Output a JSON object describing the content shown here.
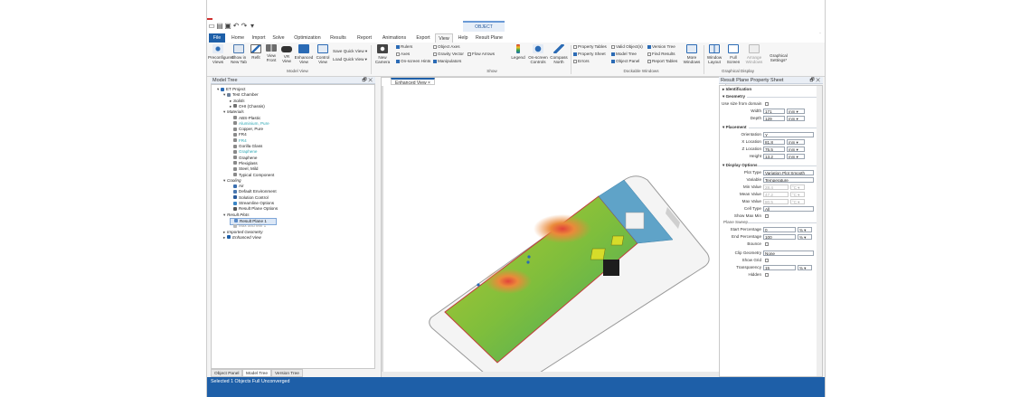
{
  "title_bar": {
    "context_tab_label": "OBJECT",
    "quick_access": [
      "new-icon",
      "open-icon",
      "save-icon",
      "undo-icon",
      "redo-icon",
      "dropdown-icon"
    ]
  },
  "tabs": [
    "File",
    "Home",
    "Import",
    "Solve",
    "Optimization",
    "Results",
    "Report",
    "Animations",
    "Export",
    "View",
    "Help",
    "Result Plane"
  ],
  "active_tab": "View",
  "ribbon": {
    "model_view": {
      "buttons": [
        "Preconfigured Views",
        "Show in New Tab",
        "Refit",
        "View Front",
        "VR View",
        "Enhanced View",
        "Control View"
      ],
      "quick_views": [
        "Save Quick View ▾",
        "Load Quick View ▾"
      ],
      "group_label": "Model View"
    },
    "new_camera": "New Camera",
    "show": {
      "checks": [
        {
          "label": "Rulers",
          "checked": true
        },
        {
          "label": "Axes",
          "checked": false
        },
        {
          "label": "On-screen Hints",
          "checked": true
        },
        {
          "label": "Object Axes",
          "checked": false
        },
        {
          "label": "Gravity Vector",
          "checked": false
        },
        {
          "label": "Flow Arrows",
          "checked": false
        },
        {
          "label": "Manipulators",
          "checked": true
        }
      ],
      "buttons": [
        "Legend",
        "On-screen Controls",
        "Compass North"
      ],
      "group_label": "Show"
    },
    "dockable": {
      "checks": [
        {
          "label": "Property Tables",
          "checked": false
        },
        {
          "label": "Property Sheet",
          "checked": true
        },
        {
          "label": "Errors",
          "checked": false
        },
        {
          "label": "Valid Object(s)",
          "checked": false
        },
        {
          "label": "Model Tree",
          "checked": true
        },
        {
          "label": "Object Panel",
          "checked": true
        },
        {
          "label": "Version Tree",
          "checked": true
        },
        {
          "label": "Find Results",
          "checked": false
        },
        {
          "label": "Report Tables",
          "checked": false
        }
      ],
      "more": "More Windows",
      "group_label": "Dockable Windows"
    },
    "graphical_display": {
      "buttons": [
        "Window Layout",
        "Full Screen",
        "Arrange Windows"
      ],
      "settings": "Graphical Settings*",
      "group_label": "Graphical Display"
    }
  },
  "model_tree": {
    "title": "Model Tree",
    "items": [
      {
        "label": "ET Project",
        "level": 0,
        "twisty": "▾",
        "icon": "project-icon",
        "style": "normal"
      },
      {
        "label": "Test Chamber",
        "level": 1,
        "twisty": "▾",
        "icon": "chamber-icon",
        "style": "normal"
      },
      {
        "label": "Solids",
        "level": 2,
        "twisty": "▸",
        "icon": "",
        "style": "italic"
      },
      {
        "label": "OHI (Chassis)",
        "level": 2,
        "twisty": "▸",
        "icon": "assembly-icon",
        "style": "normal"
      },
      {
        "label": "Materials",
        "level": 1,
        "twisty": "▾",
        "icon": "",
        "style": "italic"
      },
      {
        "label": "ABS-Plastic",
        "level": 2,
        "twisty": "",
        "icon": "material-icon",
        "style": "normal"
      },
      {
        "label": "Aluminium, Pure",
        "level": 2,
        "twisty": "",
        "icon": "material-icon",
        "style": "teal"
      },
      {
        "label": "Copper, Pure",
        "level": 2,
        "twisty": "",
        "icon": "material-icon",
        "style": "normal"
      },
      {
        "label": "FR4",
        "level": 2,
        "twisty": "",
        "icon": "material-icon",
        "style": "normal"
      },
      {
        "label": "FR4",
        "level": 2,
        "twisty": "",
        "icon": "material-icon",
        "style": "teal"
      },
      {
        "label": "Gorilla Glass",
        "level": 2,
        "twisty": "",
        "icon": "material-icon",
        "style": "normal"
      },
      {
        "label": "Graphene",
        "level": 2,
        "twisty": "",
        "icon": "material-icon",
        "style": "teal"
      },
      {
        "label": "Graphene",
        "level": 2,
        "twisty": "",
        "icon": "material-icon",
        "style": "normal"
      },
      {
        "label": "Plexiglass",
        "level": 2,
        "twisty": "",
        "icon": "material-icon",
        "style": "normal"
      },
      {
        "label": "Steel, Mild",
        "level": 2,
        "twisty": "",
        "icon": "material-icon",
        "style": "normal"
      },
      {
        "label": "Typical Component",
        "level": 2,
        "twisty": "",
        "icon": "material-icon",
        "style": "normal"
      },
      {
        "label": "Cooling",
        "level": 1,
        "twisty": "▾",
        "icon": "",
        "style": "italic"
      },
      {
        "label": "Air",
        "level": 2,
        "twisty": "",
        "icon": "air-icon",
        "style": "normal"
      },
      {
        "label": "Default Environment",
        "level": 2,
        "twisty": "",
        "icon": "environment-icon",
        "style": "normal"
      },
      {
        "label": "Solution Control",
        "level": 2,
        "twisty": "",
        "icon": "solution-icon",
        "style": "normal"
      },
      {
        "label": "Streamline Options",
        "level": 2,
        "twisty": "",
        "icon": "streamline-icon",
        "style": "normal"
      },
      {
        "label": "Result Plane Options",
        "level": 2,
        "twisty": "",
        "icon": "plane-options-icon",
        "style": "normal"
      },
      {
        "label": "Result Plots",
        "level": 1,
        "twisty": "▾",
        "icon": "",
        "style": "italic"
      },
      {
        "label": "Result Plane 1",
        "level": 2,
        "twisty": "",
        "icon": "result-plane-icon",
        "style": "selected"
      },
      {
        "label": "Max and Min 1",
        "level": 2,
        "twisty": "",
        "icon": "maxmin-icon",
        "style": "grey"
      },
      {
        "label": "Imported Geometry",
        "level": 1,
        "twisty": "▸",
        "icon": "",
        "style": "italic"
      },
      {
        "label": "Enhanced View",
        "level": 1,
        "twisty": "▸",
        "icon": "view-icon",
        "style": "italic"
      }
    ]
  },
  "bottom_tabs": [
    "Object Panel",
    "Model Tree",
    "Version Tree"
  ],
  "active_bottom_tab": "Model Tree",
  "viewer": {
    "tab_label": "Enhanced View"
  },
  "property_sheet": {
    "title": "Result Plane Property Sheet",
    "sections": {
      "identification": "▸ Identification",
      "geometry": "▾ Geometry",
      "placement": "▾ Placement",
      "display": "▾ Display Options",
      "plane_sweep": "Plane Sweep"
    },
    "use_size_from_domain": "Use size from domain",
    "width": {
      "label": "Width",
      "value": "171",
      "unit": "mm ▾"
    },
    "depth": {
      "label": "Depth",
      "value": "129",
      "unit": "mm ▾"
    },
    "orientation": {
      "label": "Orientation",
      "value": "Y"
    },
    "x_location": {
      "label": "X Location",
      "value": "81.8",
      "unit": "mm ▾"
    },
    "z_location": {
      "label": "Z Location",
      "value": "75.5",
      "unit": "mm ▾"
    },
    "height": {
      "label": "Height",
      "value": "13.2",
      "unit": "mm ▾"
    },
    "plot_type": {
      "label": "Plot Type",
      "value": "Variation Plot Smooth"
    },
    "variable": {
      "label": "Variable",
      "value": "Temperature"
    },
    "min_value": {
      "label": "Min Value",
      "value": "28.4",
      "unit": "°C ▾"
    },
    "mean_value": {
      "label": "Mean Value",
      "value": "47.2",
      "unit": "°C ▾"
    },
    "max_value": {
      "label": "Max Value",
      "value": "80.5",
      "unit": "°C ▾"
    },
    "cell_type": {
      "label": "Cell Type",
      "value": "All"
    },
    "show_max_min": "Show Max Min",
    "start_pct": {
      "label": "Start Percentage",
      "value": "0",
      "unit": "% ▾"
    },
    "end_pct": {
      "label": "End Percentage",
      "value": "100",
      "unit": "% ▾"
    },
    "bounce": "Bounce",
    "clip_geometry": {
      "label": "Clip Geometry",
      "value": "None"
    },
    "show_grid": "Show Grid",
    "transparency": {
      "label": "Transparency",
      "value": "15",
      "unit": "% ▾"
    },
    "hidden": "Hidden"
  },
  "status": "Selected 1 Objects Full Unconverged",
  "colors": {
    "accent": "#1e5fa8",
    "ribbon": "#f6f6f6",
    "panel_header": "#e9eef5"
  }
}
